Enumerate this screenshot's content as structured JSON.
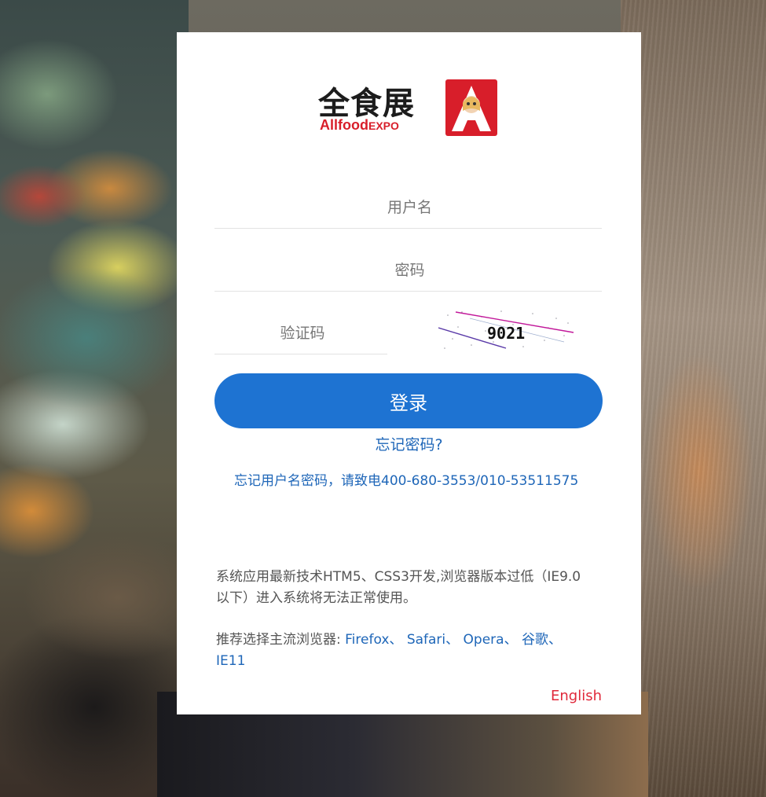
{
  "logo": {
    "cn_text": "全食展",
    "en_text_a": "Allfood",
    "en_text_expo": "EXPO"
  },
  "form": {
    "username_placeholder": "用户名",
    "password_placeholder": "密码",
    "captcha_placeholder": "验证码",
    "captcha_text": "9021",
    "login_label": "登录",
    "forgot_password": "忘记密码?"
  },
  "support": {
    "phone_text": "忘记用户名密码，请致电400-680-3553/010-53511575"
  },
  "notice": {
    "system_note": "系统应用最新技术HTM5、CSS3开发,浏览器版本过低（IE9.0以下）进入系统将无法正常使用。",
    "recommend_prefix": "推荐选择主流浏览器:",
    "browsers": [
      "Firefox、",
      "Safari、",
      "Opera、",
      "谷歌、",
      "IE11"
    ]
  },
  "language_link": "English",
  "colors": {
    "accent": "#1e73d2",
    "link": "#1e66b8",
    "lang": "#e0283a",
    "logo_red": "#d81e2a"
  }
}
